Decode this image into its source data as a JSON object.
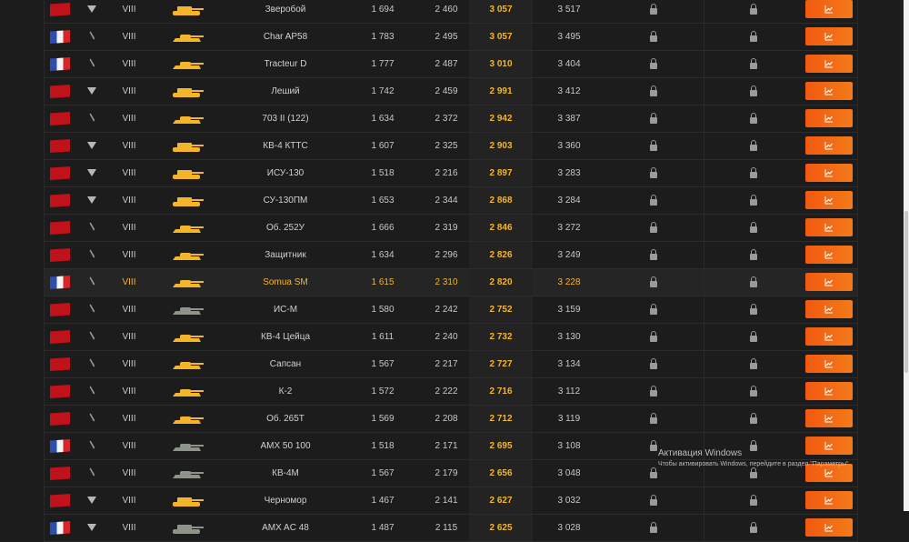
{
  "rows": [
    {
      "flag": "ussr",
      "type": "heavy",
      "tier": "VIII",
      "name": "Зверобой",
      "v1": "1 694",
      "v2": "2 460",
      "v3": "3 057",
      "v4": "3 517",
      "tank_color": "#f4b52b"
    },
    {
      "flag": "fr",
      "type": "medium",
      "tier": "VIII",
      "name": "Char AP58",
      "v1": "1 783",
      "v2": "2 495",
      "v3": "3 057",
      "v4": "3 495",
      "tank_color": "#f4b52b"
    },
    {
      "flag": "fr",
      "type": "medium",
      "tier": "VIII",
      "name": "Tracteur D",
      "v1": "1 777",
      "v2": "2 487",
      "v3": "3 010",
      "v4": "3 404",
      "tank_color": "#f4b52b"
    },
    {
      "flag": "ussr",
      "type": "heavy",
      "tier": "VIII",
      "name": "Леший",
      "v1": "1 742",
      "v2": "2 459",
      "v3": "2 991",
      "v4": "3 412",
      "tank_color": "#f4b52b"
    },
    {
      "flag": "ussr",
      "type": "medium",
      "tier": "VIII",
      "name": "703 II (122)",
      "v1": "1 634",
      "v2": "2 372",
      "v3": "2 942",
      "v4": "3 387",
      "tank_color": "#f4b52b"
    },
    {
      "flag": "ussr",
      "type": "heavy",
      "tier": "VIII",
      "name": "КВ-4 КТТС",
      "v1": "1 607",
      "v2": "2 325",
      "v3": "2 903",
      "v4": "3 360",
      "tank_color": "#f4b52b"
    },
    {
      "flag": "ussr",
      "type": "heavy",
      "tier": "VIII",
      "name": "ИСУ-130",
      "v1": "1 518",
      "v2": "2 216",
      "v3": "2 897",
      "v4": "3 283",
      "tank_color": "#f4b52b"
    },
    {
      "flag": "ussr",
      "type": "heavy",
      "tier": "VIII",
      "name": "СУ-130ПМ",
      "v1": "1 653",
      "v2": "2 344",
      "v3": "2 868",
      "v4": "3 284",
      "tank_color": "#f4b52b"
    },
    {
      "flag": "ussr",
      "type": "medium",
      "tier": "VIII",
      "name": "Об. 252У",
      "v1": "1 666",
      "v2": "2 319",
      "v3": "2 846",
      "v4": "3 272",
      "tank_color": "#f4b52b"
    },
    {
      "flag": "ussr",
      "type": "medium",
      "tier": "VIII",
      "name": "Защитник",
      "v1": "1 634",
      "v2": "2 296",
      "v3": "2 826",
      "v4": "3 249",
      "tank_color": "#f4b52b"
    },
    {
      "flag": "fr",
      "type": "medium",
      "tier": "VIII",
      "name": "Somua SM",
      "v1": "1 615",
      "v2": "2 310",
      "v3": "2 820",
      "v4": "3 228",
      "tank_color": "#f4b52b",
      "highlight": true
    },
    {
      "flag": "ussr",
      "type": "medium",
      "tier": "VIII",
      "name": "ИС-М",
      "v1": "1 580",
      "v2": "2 242",
      "v3": "2 752",
      "v4": "3 159",
      "tank_color": "#8f9488"
    },
    {
      "flag": "ussr",
      "type": "medium",
      "tier": "VIII",
      "name": "КВ-4 Цейца",
      "v1": "1 611",
      "v2": "2 240",
      "v3": "2 732",
      "v4": "3 130",
      "tank_color": "#f4b52b"
    },
    {
      "flag": "ussr",
      "type": "medium",
      "tier": "VIII",
      "name": "Сапсан",
      "v1": "1 567",
      "v2": "2 217",
      "v3": "2 727",
      "v4": "3 134",
      "tank_color": "#f4b52b"
    },
    {
      "flag": "ussr",
      "type": "medium",
      "tier": "VIII",
      "name": "К-2",
      "v1": "1 572",
      "v2": "2 222",
      "v3": "2 716",
      "v4": "3 112",
      "tank_color": "#f4b52b"
    },
    {
      "flag": "ussr",
      "type": "medium",
      "tier": "VIII",
      "name": "Об. 265Т",
      "v1": "1 569",
      "v2": "2 208",
      "v3": "2 712",
      "v4": "3 119",
      "tank_color": "#f4b52b"
    },
    {
      "flag": "fr",
      "type": "medium",
      "tier": "VIII",
      "name": "AMX 50 100",
      "v1": "1 518",
      "v2": "2 171",
      "v3": "2 695",
      "v4": "3 108",
      "tank_color": "#8f9488"
    },
    {
      "flag": "ussr",
      "type": "medium",
      "tier": "VIII",
      "name": "КВ-4М",
      "v1": "1 567",
      "v2": "2 179",
      "v3": "2 656",
      "v4": "3 048",
      "tank_color": "#8f9488"
    },
    {
      "flag": "ussr",
      "type": "heavy",
      "tier": "VIII",
      "name": "Черномор",
      "v1": "1 467",
      "v2": "2 141",
      "v3": "2 627",
      "v4": "3 032",
      "tank_color": "#f4b52b"
    },
    {
      "flag": "fr",
      "type": "heavy",
      "tier": "VIII",
      "name": "AMX AC 48",
      "v1": "1 487",
      "v2": "2 115",
      "v3": "2 625",
      "v4": "3 028",
      "tank_color": "#8f9488"
    }
  ],
  "windows_activation": {
    "title": "Активация Windows",
    "subtitle": "Чтобы активировать Windows, перейдите в раздел \"Параметры\"."
  }
}
